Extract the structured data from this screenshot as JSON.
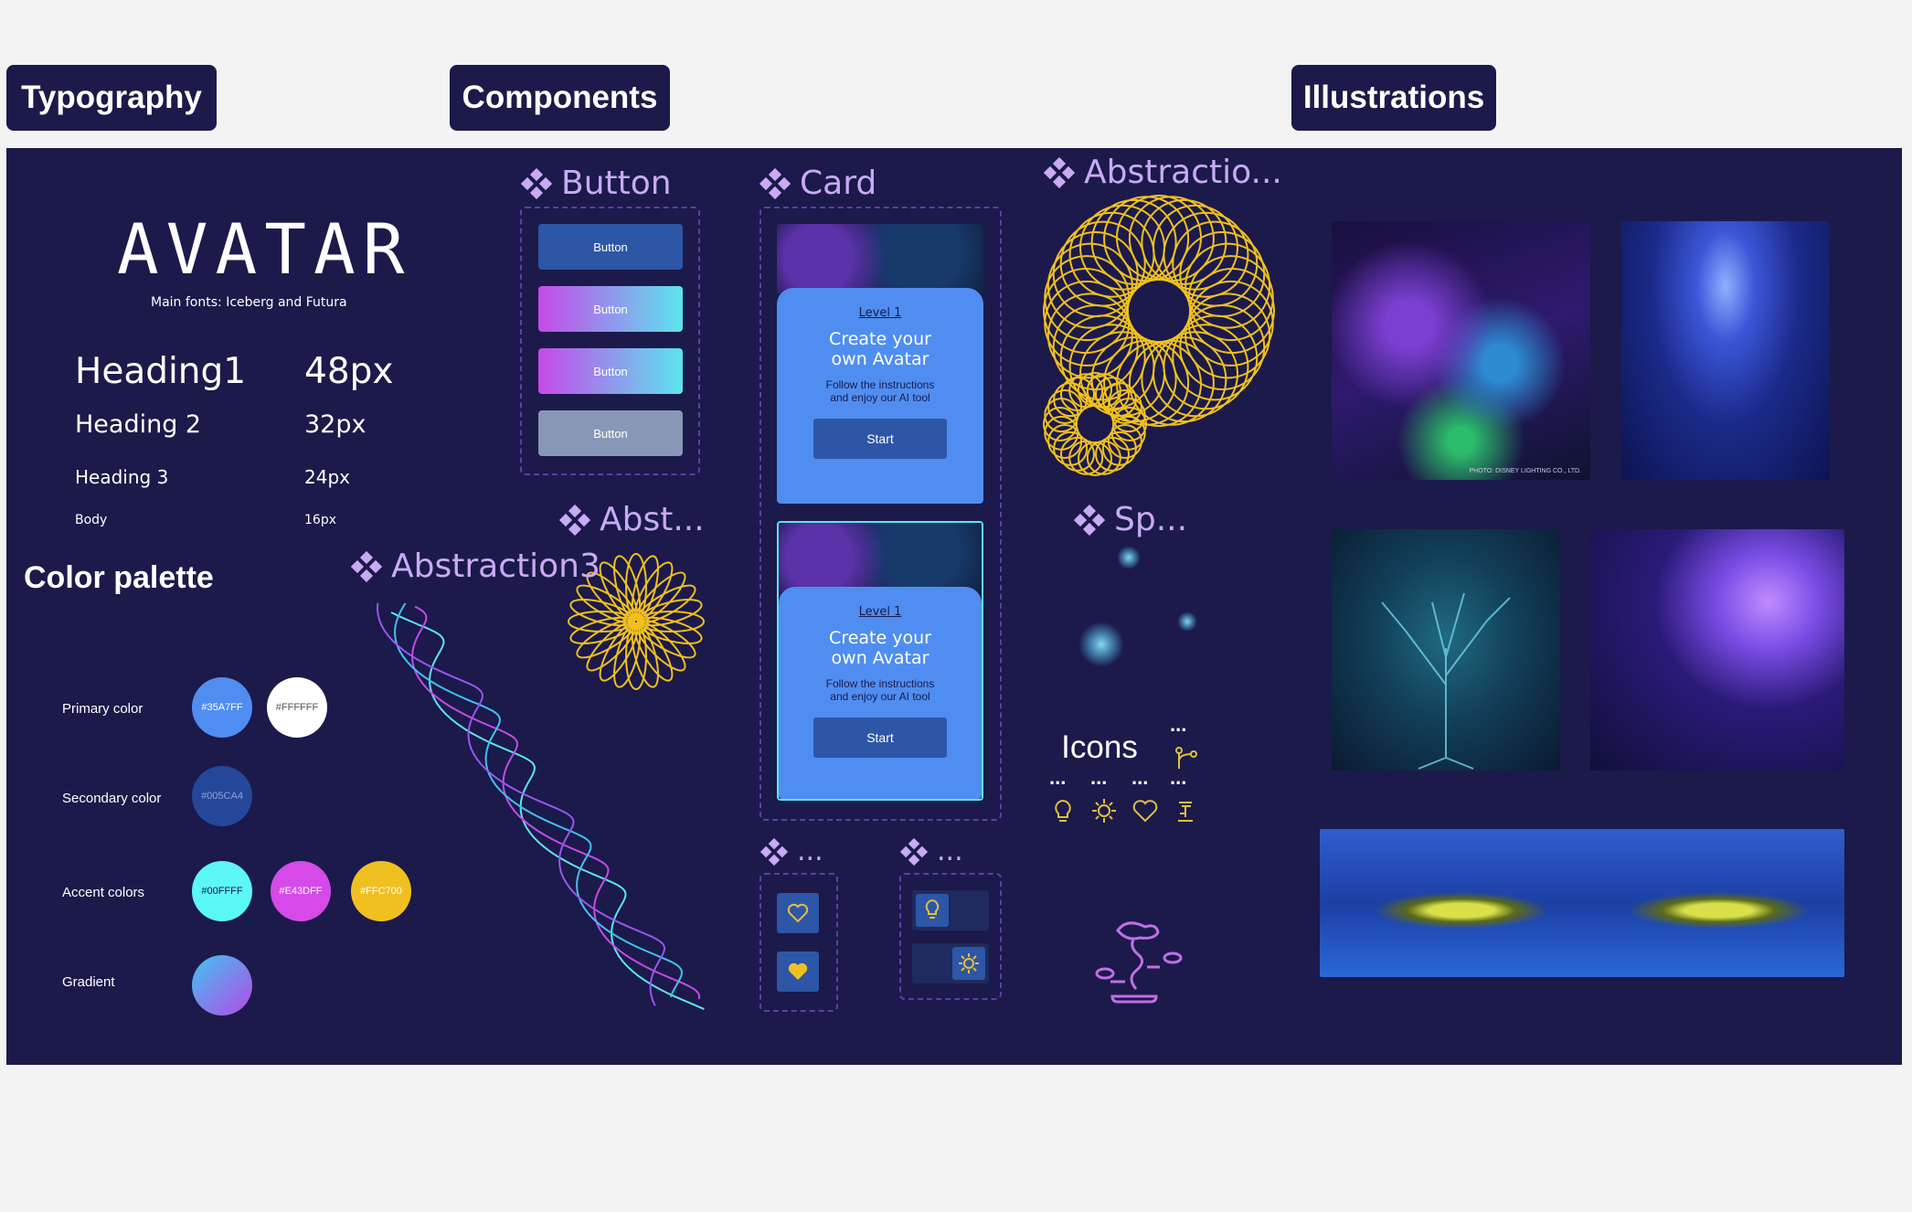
{
  "tabs": {
    "typography": "Typography",
    "components": "Components",
    "illustrations": "Illustrations"
  },
  "typography": {
    "logo": "AVATAR",
    "fonts_note": "Main fonts: Iceberg and Futura",
    "rows": [
      {
        "name": "Heading1",
        "size": "48px"
      },
      {
        "name": "Heading 2",
        "size": "32px"
      },
      {
        "name": "Heading 3",
        "size": "24px"
      },
      {
        "name": "Body",
        "size": "16px"
      }
    ]
  },
  "palette": {
    "title": "Color palette",
    "primary_label": "Primary color",
    "secondary_label": "Secondary color",
    "accent_label": "Accent colors",
    "gradient_label": "Gradient",
    "primary": [
      "#35A7FF",
      "#FFFFFF"
    ],
    "secondary": [
      "#005CA4"
    ],
    "accent": [
      "#00FFFF",
      "#E43DFF",
      "#FFC700"
    ],
    "colors": {
      "primary": [
        "#4f8ef0",
        "#ffffff"
      ],
      "secondary": [
        "#24479a"
      ],
      "accent": [
        "#5cf7f7",
        "#d54ae8",
        "#f0c020"
      ]
    }
  },
  "components": {
    "button_title": "Button",
    "buttons": [
      "Button",
      "Button",
      "Button",
      "Button"
    ],
    "card_title": "Card",
    "card": {
      "level": "Level 1",
      "heading_line1": "Create your",
      "heading_line2": "own Avatar",
      "text_line1": "Follow the instructions",
      "text_line2": "and enjoy our AI tool",
      "button": "Start"
    },
    "abstraction1": "Abstractio...",
    "abstraction2": "Abst...",
    "abstraction3": "Abstraction3",
    "sp": "Sp...",
    "icons_title": "Icons",
    "ellipsis": "...",
    "small1": "...",
    "small2": "..."
  },
  "illustrations": {
    "credit": "PHOTO: DISNEY LIGHTING CO., LTD."
  }
}
